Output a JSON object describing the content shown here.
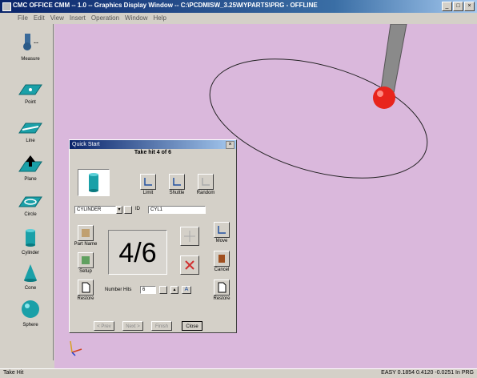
{
  "window": {
    "title": "CMC OFFICE CMM -- 1.0 -- Graphics Display Window -- C:\\PCDMISW_3.25\\MYPARTS\\PRG - OFFLINE"
  },
  "menubar": {
    "items": [
      "File",
      "Edit",
      "View",
      "Insert",
      "Operation",
      "Window",
      "Help"
    ]
  },
  "toolbar": {
    "header_label": "Measure",
    "tools": [
      {
        "label": "Point",
        "icon": "point-plane-icon"
      },
      {
        "label": "Line",
        "icon": "line-plane-icon"
      },
      {
        "label": "Plane",
        "icon": "plane-arrow-icon"
      },
      {
        "label": "Circle",
        "icon": "circle-plane-icon"
      },
      {
        "label": "Cylinder",
        "icon": "cylinder-icon"
      },
      {
        "label": "Cone",
        "icon": "cone-icon"
      },
      {
        "label": "Sphere",
        "icon": "sphere-icon"
      }
    ]
  },
  "dialog": {
    "title": "Quick Start",
    "subtitle": "Take hit 4 of 6",
    "mode_buttons": [
      "Limit",
      "Shuttle",
      "Random"
    ],
    "feature_select": "CYLINDER",
    "name_label": "ID",
    "name_value": "CYL1",
    "counter": "4/6",
    "side_buttons_left": [
      "Part Name",
      "Setup",
      "Restore"
    ],
    "side_buttons_right": [
      "Move",
      "Cancel",
      "Restore"
    ],
    "number_label": "Number Hits",
    "number_value": "6",
    "bottom_buttons": [
      "< Prev",
      "Next >",
      "Finish",
      "Close"
    ]
  },
  "statusbar": {
    "left": "Take Hit",
    "right": "EASY 0.1854 0.4120 -0.0251 In  PRG"
  },
  "colors": {
    "viewport": "#dab8dc",
    "probe_tip": "#e8241c",
    "probe_shaft": "#8a8a8a"
  }
}
